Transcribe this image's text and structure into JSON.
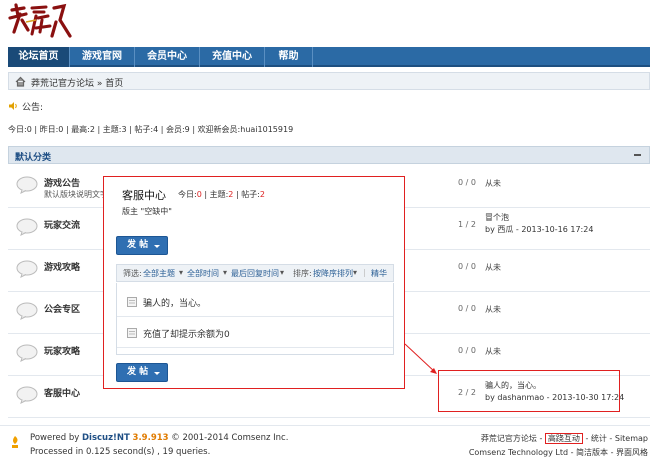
{
  "logo": {
    "alt": "莽荒记"
  },
  "nav": {
    "items": [
      {
        "label": "论坛首页",
        "active": true
      },
      {
        "label": "游戏官网"
      },
      {
        "label": "会员中心"
      },
      {
        "label": "充值中心"
      },
      {
        "label": "帮助"
      }
    ]
  },
  "breadcrumb": {
    "text": "莽荒记官方论坛 » 首页"
  },
  "notice": {
    "label": "公告:"
  },
  "stats": {
    "today_label": "今日:",
    "today": "0",
    "yesterday_label": "昨日:",
    "yesterday": "0",
    "max_label": "最高:",
    "max": "2",
    "topics_label": "主题:",
    "topics": "3",
    "posts_label": "帖子:",
    "posts": "4",
    "members_label": "会员:",
    "members": "9",
    "welcome_label": "欢迎新会员:",
    "new_member": "huai1015919"
  },
  "category": {
    "title": "默认分类"
  },
  "forums": [
    {
      "name": "游戏公告",
      "desc": "默认版块说明文字",
      "counts": "0 / 0",
      "last": "从未"
    },
    {
      "name": "玩家交流",
      "desc": "",
      "counts": "1 / 2",
      "last_title": "冒个泡",
      "last_by": "by 西瓜 - 2013-10-16 17:24"
    },
    {
      "name": "游戏攻略",
      "desc": "",
      "counts": "0 / 0",
      "last": "从未"
    },
    {
      "name": "公会专区",
      "desc": "",
      "counts": "0 / 0",
      "last": "从未"
    },
    {
      "name": "玩家攻略",
      "desc": "",
      "counts": "0 / 0",
      "last": "从未"
    },
    {
      "name": "客服中心",
      "desc": "",
      "counts": "2 / 2",
      "last_title": "骗人的，当心。",
      "last_by": "by dashanmao - 2013-10-30 17:24"
    }
  ],
  "popup": {
    "title": "客服中心",
    "today_label": "今日:",
    "today": "0",
    "topics_label": "主题:",
    "topics": "2",
    "posts_label": "帖子:",
    "posts": "2",
    "moderator": "版主 \"空缺中\"",
    "post_button": "发 帖",
    "filter": {
      "label": "筛选:",
      "all_topics": "全部主题",
      "all_time": "全部时间",
      "last_reply": "最后回复时间",
      "sort_label": "排序:",
      "order": "按降序排列",
      "digest": "精华"
    },
    "threads": [
      {
        "title": "骗人的，当心。"
      },
      {
        "title": "充值了却提示余额为0"
      }
    ]
  },
  "footer": {
    "powered_by": "Powered by",
    "brand": "Discuz!NT",
    "version": "3.9.913",
    "copyright": "© 2001-2014 Comsenz Inc.",
    "processed": "Processed in 0.125 second(s) , 19 queries.",
    "site_name": "莽荒记官方论坛",
    "links_sep": "-",
    "link_high": "高跷互动",
    "link_stats": "统计",
    "link_sitemap": "Sitemap",
    "company": "Comsenz Technology Ltd",
    "link_simple": "简洁版本",
    "link_style": "界面风格"
  },
  "colors": {
    "nav_bg": "#2b6aa5",
    "highlight": "#e02020",
    "version": "#e07b00"
  }
}
